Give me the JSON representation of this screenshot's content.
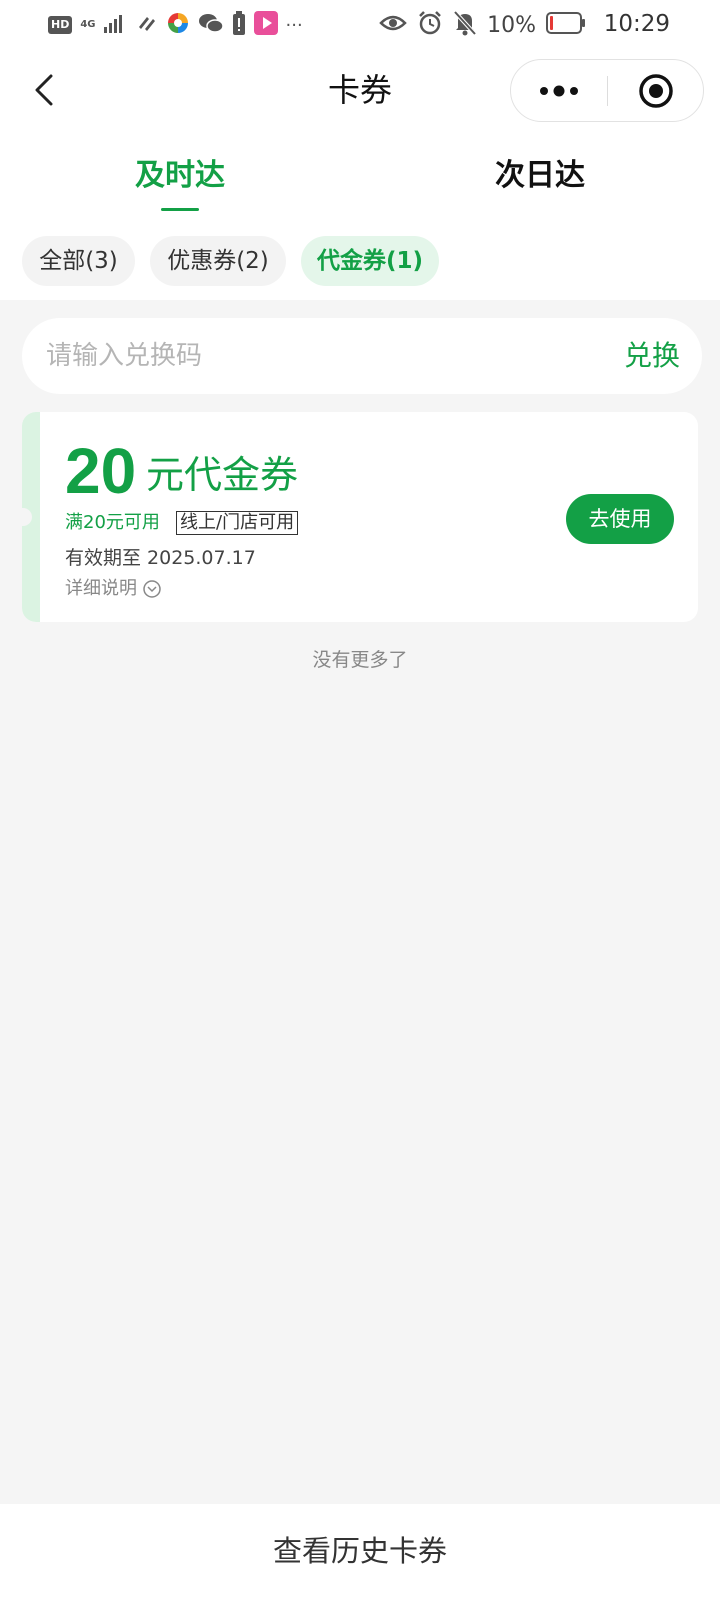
{
  "status_bar": {
    "hd": "HD",
    "network": "4G",
    "more": "···",
    "battery": "10%",
    "time": "10:29",
    "icons": [
      "signal-icon",
      "link-icon",
      "colorful-app-icon",
      "wechat-icon",
      "battery-alert-icon",
      "video-app-icon",
      "eye-icon",
      "alarm-icon",
      "bell-off-icon",
      "battery-icon"
    ]
  },
  "nav": {
    "title": "卡券",
    "back_icon": "chevron-left-icon",
    "more_icon": "more-dots-icon",
    "close_icon": "target-close-icon"
  },
  "tabs": [
    {
      "label": "及时达",
      "active": true
    },
    {
      "label": "次日达",
      "active": false
    }
  ],
  "filters": [
    {
      "label": "全部(3)",
      "active": false
    },
    {
      "label": "优惠券(2)",
      "active": false
    },
    {
      "label": "代金券(1)",
      "active": true
    }
  ],
  "redeem": {
    "placeholder": "请输入兑换码",
    "value": "",
    "button": "兑换"
  },
  "coupons": [
    {
      "amount": "20",
      "unit": "元代金券",
      "condition": "满20元可用",
      "tag": "线上/门店可用",
      "expiry": "有效期至 2025.07.17",
      "detail": "详细说明",
      "button": "去使用"
    }
  ],
  "list_end": "没有更多了",
  "bottom": {
    "history": "查看历史卡券"
  },
  "colors": {
    "accent": "#13a046",
    "accent_light": "#e4f6ea",
    "background": "#f5f5f5"
  }
}
